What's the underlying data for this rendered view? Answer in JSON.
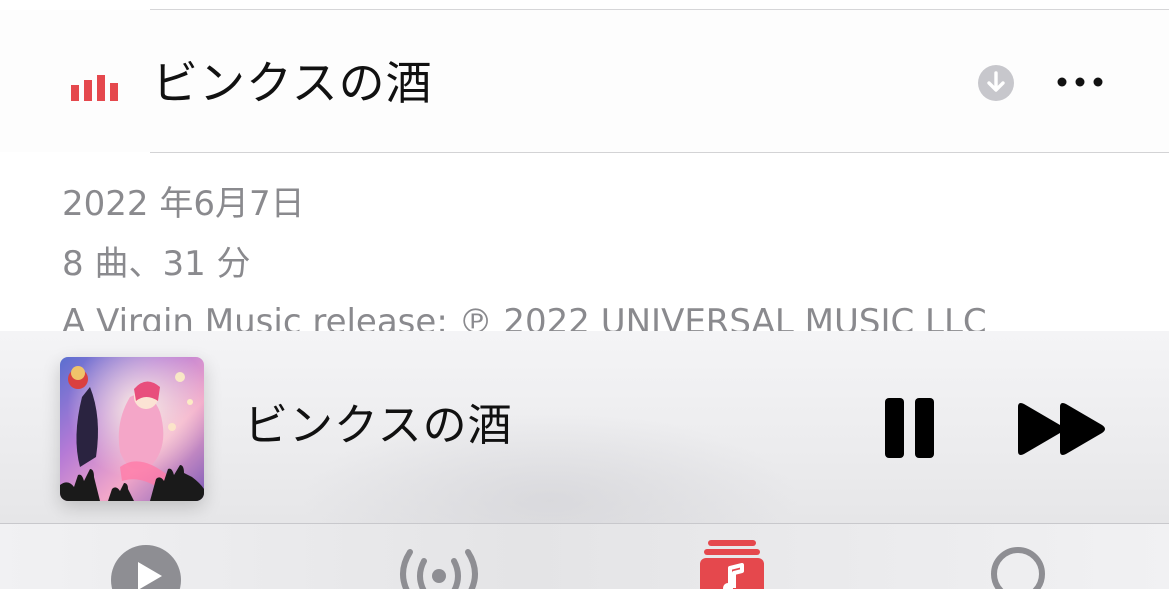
{
  "track": {
    "title": "ビンクスの酒",
    "download_icon": "download-icon",
    "more_icon": "more-icon",
    "playing_indicator_icon": "equalizer-icon"
  },
  "album_info": {
    "release_date": "2022 年6月7日",
    "track_count": "8 曲、31 分",
    "copyright": "A Virgin Music release; ℗ 2022 UNIVERSAL MUSIC LLC"
  },
  "mini_player": {
    "title": "ビンクスの酒",
    "pause_icon": "pause-icon",
    "forward_icon": "fast-forward-icon"
  },
  "tab_bar": {
    "tabs": [
      {
        "icon": "play-circle-icon",
        "active": false
      },
      {
        "icon": "radio-icon",
        "active": false
      },
      {
        "icon": "library-icon",
        "active": true
      },
      {
        "icon": "search-icon",
        "active": false
      }
    ]
  },
  "colors": {
    "accent": "#e5484d",
    "secondary_text": "#8a8a8e",
    "icon_gray": "#8e8e93"
  }
}
